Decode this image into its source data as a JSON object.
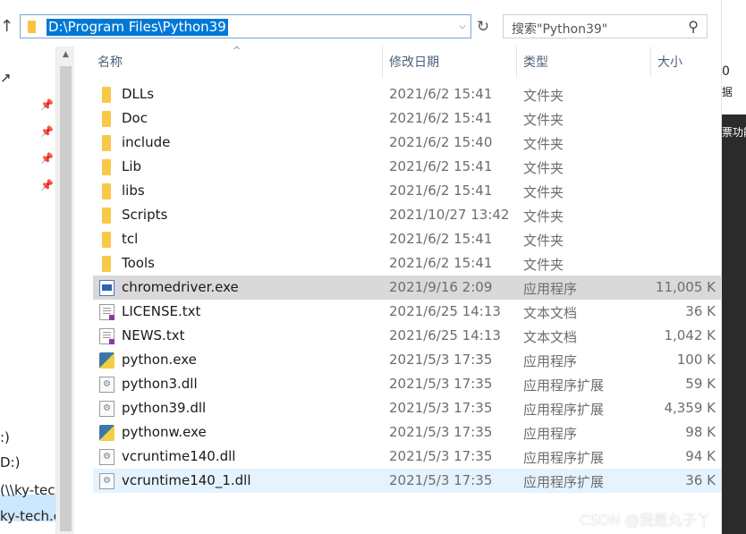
{
  "address_bar": {
    "path": "D:\\Program Files\\Python39",
    "up_icon": "up-arrow-icon",
    "dropdown_icon": "chevron-down-icon",
    "refresh_icon": "refresh-icon"
  },
  "search": {
    "placeholder": "搜索\"Python39\"",
    "icon": "search-icon"
  },
  "columns": {
    "name": "名称",
    "date": "修改日期",
    "type": "类型",
    "size": "大小"
  },
  "nav_fragments": [
    "(\\\\ky-tec",
    "ky-tech.c",
    ":)",
    "D:)"
  ],
  "right_fragments": [
    "0",
    "据",
    "票功能"
  ],
  "files": [
    {
      "name": "DLLs",
      "date": "2021/6/2 15:41",
      "type": "文件夹",
      "size": "",
      "icon": "folder-icon"
    },
    {
      "name": "Doc",
      "date": "2021/6/2 15:41",
      "type": "文件夹",
      "size": "",
      "icon": "folder-icon"
    },
    {
      "name": "include",
      "date": "2021/6/2 15:40",
      "type": "文件夹",
      "size": "",
      "icon": "folder-icon"
    },
    {
      "name": "Lib",
      "date": "2021/6/2 15:41",
      "type": "文件夹",
      "size": "",
      "icon": "folder-icon"
    },
    {
      "name": "libs",
      "date": "2021/6/2 15:41",
      "type": "文件夹",
      "size": "",
      "icon": "folder-icon"
    },
    {
      "name": "Scripts",
      "date": "2021/10/27 13:42",
      "type": "文件夹",
      "size": "",
      "icon": "folder-icon"
    },
    {
      "name": "tcl",
      "date": "2021/6/2 15:41",
      "type": "文件夹",
      "size": "",
      "icon": "folder-icon"
    },
    {
      "name": "Tools",
      "date": "2021/6/2 15:41",
      "type": "文件夹",
      "size": "",
      "icon": "folder-icon"
    },
    {
      "name": "chromedriver.exe",
      "date": "2021/9/16 2:09",
      "type": "应用程序",
      "size": "11,005 K",
      "icon": "exe-icon"
    },
    {
      "name": "LICENSE.txt",
      "date": "2021/6/25 14:13",
      "type": "文本文档",
      "size": "36 K",
      "icon": "text-file-icon"
    },
    {
      "name": "NEWS.txt",
      "date": "2021/6/25 14:13",
      "type": "文本文档",
      "size": "1,042 K",
      "icon": "text-file-icon"
    },
    {
      "name": "python.exe",
      "date": "2021/5/3 17:35",
      "type": "应用程序",
      "size": "100 K",
      "icon": "python-icon"
    },
    {
      "name": "python3.dll",
      "date": "2021/5/3 17:35",
      "type": "应用程序扩展",
      "size": "59 K",
      "icon": "dll-icon"
    },
    {
      "name": "python39.dll",
      "date": "2021/5/3 17:35",
      "type": "应用程序扩展",
      "size": "4,359 K",
      "icon": "dll-icon"
    },
    {
      "name": "pythonw.exe",
      "date": "2021/5/3 17:35",
      "type": "应用程序",
      "size": "98 K",
      "icon": "python-icon"
    },
    {
      "name": "vcruntime140.dll",
      "date": "2021/5/3 17:35",
      "type": "应用程序扩展",
      "size": "94 K",
      "icon": "dll-icon"
    },
    {
      "name": "vcruntime140_1.dll",
      "date": "2021/5/3 17:35",
      "type": "应用程序扩展",
      "size": "36 K",
      "icon": "dll-icon"
    }
  ],
  "selected_index": 8,
  "hover_index": 16,
  "watermark": "CSDN @我是丸子丫",
  "colors": {
    "selection_blue": "#0078d7",
    "row_selected": "#d9d9d9",
    "row_hover": "#e5f3ff",
    "folder_yellow": "#f8c948"
  }
}
